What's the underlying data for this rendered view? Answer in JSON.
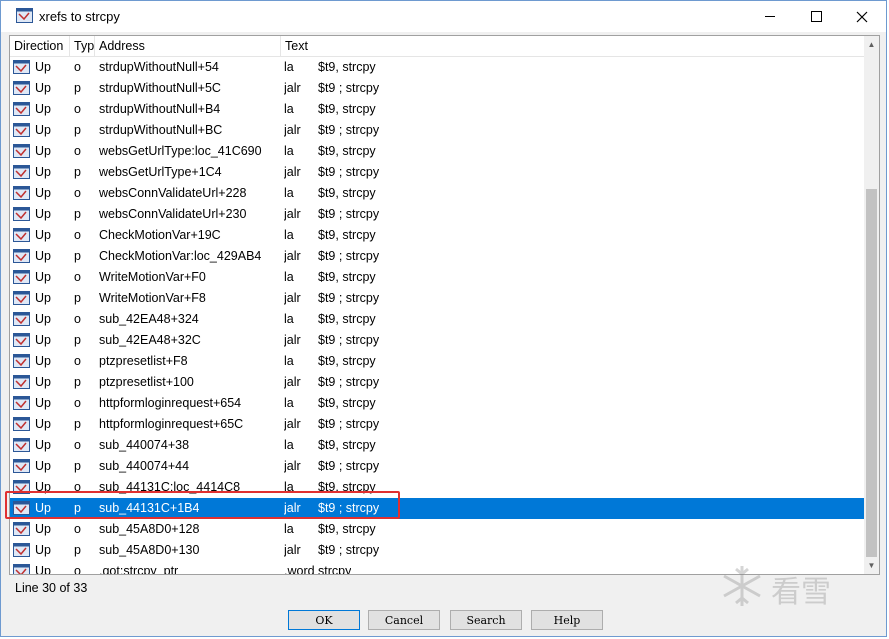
{
  "window": {
    "title": "xrefs to strcpy"
  },
  "columns": {
    "direction": "Direction",
    "type": "Typ",
    "address": "Address",
    "text": "Text"
  },
  "rows": [
    {
      "direction": "Up",
      "type": "o",
      "address": "strdupWithoutNull+54",
      "text_op": "la",
      "text_arg": "$t9, strcpy"
    },
    {
      "direction": "Up",
      "type": "p",
      "address": "strdupWithoutNull+5C",
      "text_op": "jalr",
      "text_arg": "$t9 ; strcpy"
    },
    {
      "direction": "Up",
      "type": "o",
      "address": "strdupWithoutNull+B4",
      "text_op": "la",
      "text_arg": "$t9, strcpy"
    },
    {
      "direction": "Up",
      "type": "p",
      "address": "strdupWithoutNull+BC",
      "text_op": "jalr",
      "text_arg": "$t9 ; strcpy"
    },
    {
      "direction": "Up",
      "type": "o",
      "address": "websGetUrlType:loc_41C690",
      "text_op": "la",
      "text_arg": "$t9, strcpy"
    },
    {
      "direction": "Up",
      "type": "p",
      "address": "websGetUrlType+1C4",
      "text_op": "jalr",
      "text_arg": "$t9 ; strcpy"
    },
    {
      "direction": "Up",
      "type": "o",
      "address": "websConnValidateUrl+228",
      "text_op": "la",
      "text_arg": "$t9, strcpy"
    },
    {
      "direction": "Up",
      "type": "p",
      "address": "websConnValidateUrl+230",
      "text_op": "jalr",
      "text_arg": "$t9 ; strcpy"
    },
    {
      "direction": "Up",
      "type": "o",
      "address": "CheckMotionVar+19C",
      "text_op": "la",
      "text_arg": "$t9, strcpy"
    },
    {
      "direction": "Up",
      "type": "p",
      "address": "CheckMotionVar:loc_429AB4",
      "text_op": "jalr",
      "text_arg": "$t9 ; strcpy"
    },
    {
      "direction": "Up",
      "type": "o",
      "address": "WriteMotionVar+F0",
      "text_op": "la",
      "text_arg": "$t9, strcpy"
    },
    {
      "direction": "Up",
      "type": "p",
      "address": "WriteMotionVar+F8",
      "text_op": "jalr",
      "text_arg": "$t9 ; strcpy"
    },
    {
      "direction": "Up",
      "type": "o",
      "address": "sub_42EA48+324",
      "text_op": "la",
      "text_arg": "$t9, strcpy"
    },
    {
      "direction": "Up",
      "type": "p",
      "address": "sub_42EA48+32C",
      "text_op": "jalr",
      "text_arg": "$t9 ; strcpy"
    },
    {
      "direction": "Up",
      "type": "o",
      "address": "ptzpresetlist+F8",
      "text_op": "la",
      "text_arg": "$t9, strcpy"
    },
    {
      "direction": "Up",
      "type": "p",
      "address": "ptzpresetlist+100",
      "text_op": "jalr",
      "text_arg": "$t9 ; strcpy"
    },
    {
      "direction": "Up",
      "type": "o",
      "address": "httpformloginrequest+654",
      "text_op": "la",
      "text_arg": "$t9, strcpy"
    },
    {
      "direction": "Up",
      "type": "p",
      "address": "httpformloginrequest+65C",
      "text_op": "jalr",
      "text_arg": "$t9 ; strcpy"
    },
    {
      "direction": "Up",
      "type": "o",
      "address": "sub_440074+38",
      "text_op": "la",
      "text_arg": "$t9, strcpy"
    },
    {
      "direction": "Up",
      "type": "p",
      "address": "sub_440074+44",
      "text_op": "jalr",
      "text_arg": "$t9 ; strcpy"
    },
    {
      "direction": "Up",
      "type": "o",
      "address": "sub_44131C:loc_4414C8",
      "text_op": "la",
      "text_arg": "$t9, strcpy"
    },
    {
      "direction": "Up",
      "type": "p",
      "address": "sub_44131C+1B4",
      "text_op": "jalr",
      "text_arg": "$t9 ; strcpy",
      "selected": true
    },
    {
      "direction": "Up",
      "type": "o",
      "address": "sub_45A8D0+128",
      "text_op": "la",
      "text_arg": "$t9, strcpy"
    },
    {
      "direction": "Up",
      "type": "p",
      "address": "sub_45A8D0+130",
      "text_op": "jalr",
      "text_arg": "$t9 ; strcpy"
    },
    {
      "direction": "Up",
      "type": "o",
      "address": ".got:strcpy_ptr",
      "text_op": ".word",
      "text_arg": "strcpy"
    }
  ],
  "status": {
    "line_info": "Line 30 of 33"
  },
  "buttons": {
    "ok": "OK",
    "cancel": "Cancel",
    "search": "Search",
    "help": "Help"
  },
  "watermark": {
    "text": "看雪"
  },
  "colors": {
    "selection": "#0078d7",
    "highlight_box": "#e03030"
  }
}
